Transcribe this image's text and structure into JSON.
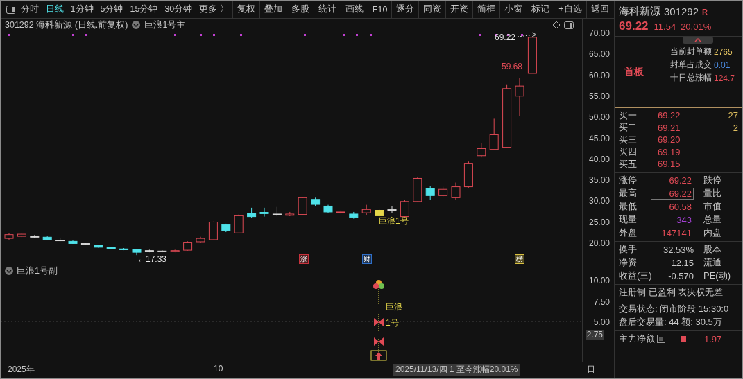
{
  "toolbar": {
    "period_tabs": [
      {
        "label": "分时",
        "selected": false
      },
      {
        "label": "日线",
        "selected": true
      },
      {
        "label": "1分钟",
        "selected": false
      },
      {
        "label": "5分钟",
        "selected": false
      },
      {
        "label": "15分钟",
        "selected": false
      },
      {
        "label": "30分钟",
        "selected": false
      }
    ],
    "more": "更多 〉",
    "buttons": [
      "复权",
      "叠加",
      "多股",
      "统计",
      "画线",
      "F10",
      "逐分",
      "同资",
      "开资",
      "简框",
      "小窗",
      "标记",
      "+自选"
    ],
    "back": "返回"
  },
  "main_chart": {
    "title": "301292 海科新源 (日线.前复权)",
    "indicator": "巨浪1号主",
    "price_ticks": [
      "70.00",
      "65.00",
      "60.00",
      "55.00",
      "50.00",
      "45.00",
      "40.00",
      "35.00",
      "30.00",
      "25.00",
      "20.00"
    ],
    "last_price_label": "69.22",
    "high_label": "59.68",
    "low_label": "←17.33",
    "signal_label": "巨浪1号",
    "events": [
      {
        "label": "涨",
        "color": "#c8323c"
      },
      {
        "label": "财",
        "color": "#2f6fc8"
      },
      {
        "label": "榜",
        "color": "#d8c040"
      }
    ]
  },
  "sub_chart": {
    "title": "巨浪1号副",
    "ticks": [
      {
        "label": "10.00",
        "selected": false
      },
      {
        "label": "7.50",
        "selected": false
      },
      {
        "label": "5.00",
        "selected": false
      },
      {
        "label": "2.75",
        "selected": true
      }
    ],
    "signal_text": [
      "巨浪",
      "1号"
    ]
  },
  "time_axis": {
    "labels": [
      "2025年",
      "10"
    ],
    "cursor": "2025/11/13/四 1 至今涨幅20.01%",
    "period": "日"
  },
  "quote": {
    "name": "海科新源",
    "code": "301292",
    "badge": "R",
    "price": "69.22",
    "change": "11.54",
    "change_pct": "20.01%",
    "board": "首板",
    "metrics": [
      {
        "label": "当前封单额",
        "value": "2765",
        "color": "#e0c060"
      },
      {
        "label": "封单占成交",
        "value": "0.01",
        "color": "#4a8ae0"
      },
      {
        "label": "十日总涨幅",
        "value": "124.7",
        "color": "#e04a55"
      }
    ],
    "bids": [
      {
        "label": "买一",
        "price": "69.22",
        "volume": "27"
      },
      {
        "label": "买二",
        "price": "69.21",
        "volume": "2"
      },
      {
        "label": "买三",
        "price": "69.20"
      },
      {
        "label": "买四",
        "price": "69.19"
      },
      {
        "label": "买五",
        "price": "69.15"
      }
    ],
    "stats": [
      {
        "label": "涨停",
        "value": "69.22",
        "color": "#e04a55",
        "highlighted": false,
        "label_2": "跌停"
      },
      {
        "label": "最高",
        "value": "69.22",
        "color": "#e04a55",
        "highlighted": true,
        "label_2": "量比"
      },
      {
        "label": "最低",
        "value": "60.58",
        "color": "#e04a55",
        "highlighted": false,
        "label_2": "市值"
      },
      {
        "label": "现量",
        "value": "343",
        "color": "#a040d0",
        "highlighted": false,
        "label_2": "总量"
      },
      {
        "label": "外盘",
        "value": "147141",
        "color": "#e04a55",
        "highlighted": false,
        "label_2": "内盘"
      }
    ],
    "fundamentals": [
      {
        "label": "换手",
        "value": "32.53%",
        "label_2": "股本"
      },
      {
        "label": "净资",
        "value": "12.15",
        "label_2": "流通"
      },
      {
        "label": "收益(三)",
        "value": "-0.570",
        "label_2": "PE(动)"
      }
    ],
    "tags": "注册制 已盈利 表决权无差",
    "trade_status": "交易状态: 闭市阶段 15:30:0",
    "after_hours": "盘后交易量: 44  额: 30.5万",
    "main_flow": {
      "label": "主力净额",
      "value": "1.97"
    }
  }
}
